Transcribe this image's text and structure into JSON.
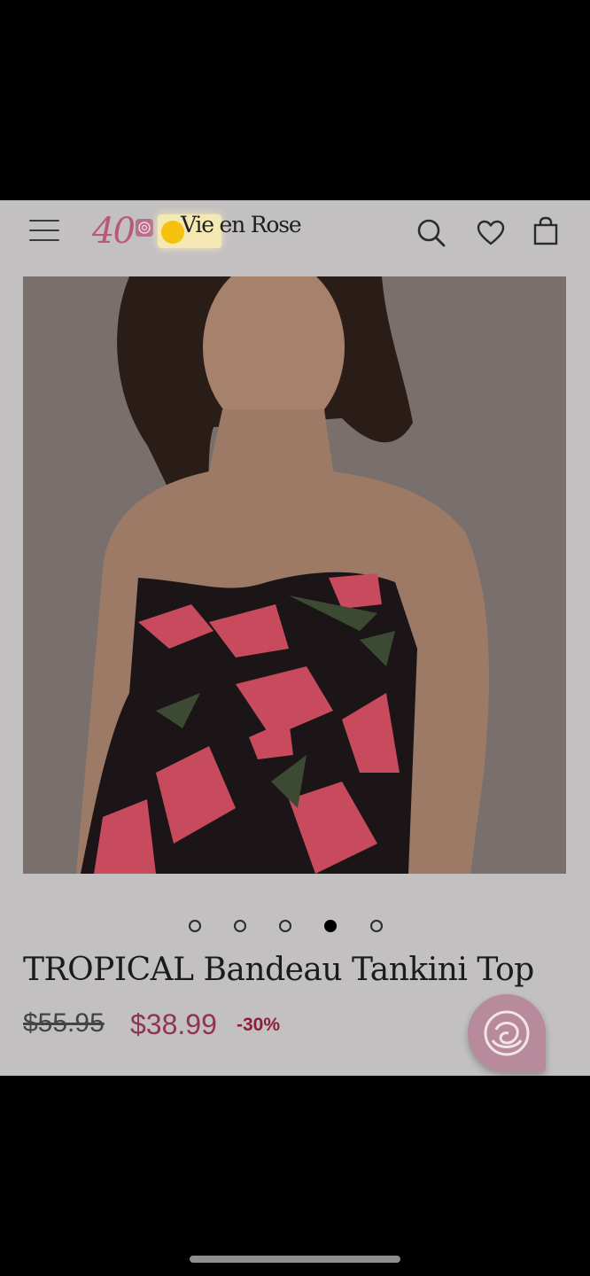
{
  "header": {
    "logo_badge": "40",
    "logo_text": "Vie en Rose",
    "icons": {
      "menu": "hamburger-menu-icon",
      "search": "search-icon",
      "wishlist": "heart-icon",
      "cart": "shopping-bag-icon"
    }
  },
  "gallery": {
    "image_alt": "Model wearing strapless black tankini top with red and pink tropical floral print",
    "total_images": 5,
    "active_index": 4
  },
  "product": {
    "title": "TROPICAL Bandeau Tankini Top",
    "original_price": "$55.95",
    "sale_price": "$38.99",
    "discount": "-30%"
  },
  "chat": {
    "icon": "rose-chat-icon"
  },
  "colors": {
    "sale_price": "#8f3457",
    "discount": "#8a2038",
    "brand_pink": "#b7587d"
  }
}
